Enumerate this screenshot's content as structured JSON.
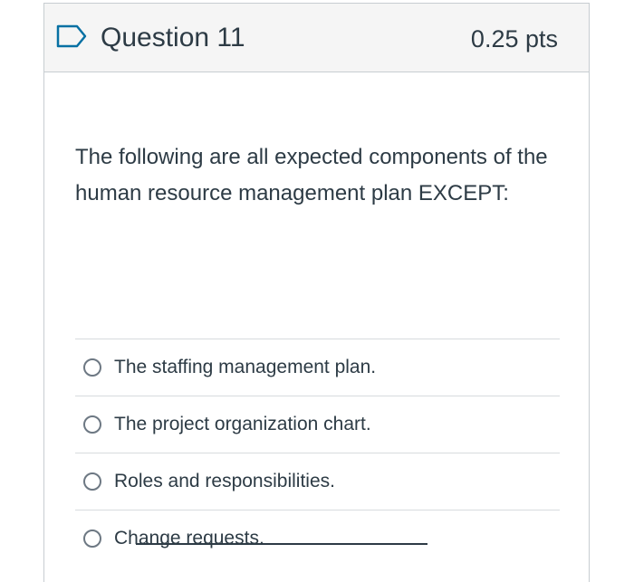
{
  "question": {
    "title": "Question 11",
    "points": "0.25 pts",
    "flag_icon": "flag-outline-icon",
    "text": "The following are all expected components of the human resource management plan EXCEPT:",
    "answers": [
      {
        "label": "The staffing management plan.",
        "selected": false
      },
      {
        "label": "The project organization chart.",
        "selected": false
      },
      {
        "label": "Roles and responsibilities.",
        "selected": false
      },
      {
        "label": "Change requests.",
        "selected": false
      }
    ]
  },
  "colors": {
    "text": "#2d3b45",
    "header_bg": "#f5f5f5",
    "border": "#c7cdd1",
    "flag_stroke": "#0770a3"
  }
}
